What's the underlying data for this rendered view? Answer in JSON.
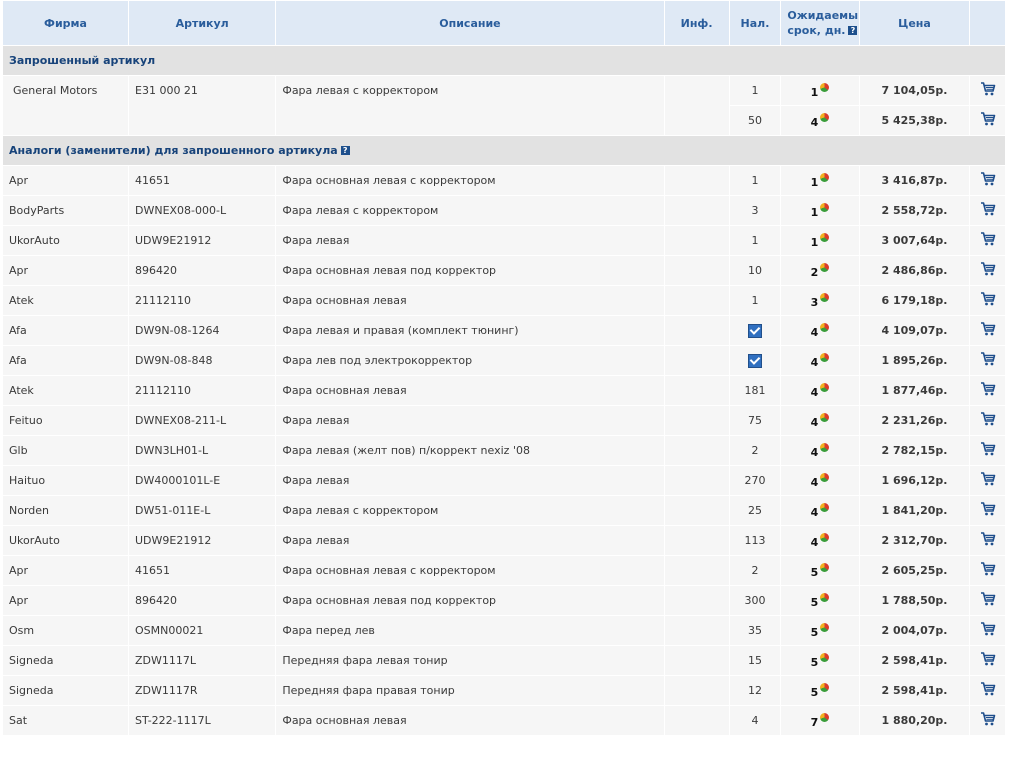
{
  "header": {
    "firm": "Фирма",
    "article": "Артикул",
    "description": "Описание",
    "info": "Инф.",
    "stock": "Нал.",
    "expected_line1": "Ожидаемый",
    "expected_line2": "срок, дн.",
    "help_glyph": "?",
    "price": "Цена"
  },
  "sections": {
    "requested": "Запрошенный артикул",
    "analogs": "Аналоги (заменители) для запрошенного артикула"
  },
  "icons": {
    "cart": "shopping-cart-icon",
    "delivery_pie": "pie-chart-icon",
    "help": "help-icon",
    "in_stock_check": "checkbox-checked-icon"
  },
  "colors": {
    "header_bg": "#dfe9f5",
    "header_text": "#2a5d9c",
    "section_bg": "#e2e2e2",
    "row_bg": "#f6f6f6",
    "link": "#1f5fa8"
  },
  "requested": {
    "firm": "General Motors",
    "article": "E31 000 21",
    "description": "Фара левая с корректором",
    "offers": [
      {
        "stock": "1",
        "days": "1",
        "price": "7 104,05р."
      },
      {
        "stock": "50",
        "days": "4",
        "price": "5 425,38р."
      }
    ]
  },
  "analogs": [
    {
      "firm": "Apr",
      "article": "41651",
      "description": "Фара основная левая с корректором",
      "stock": "1",
      "stock_check": false,
      "days": "1",
      "price": "3 416,87р."
    },
    {
      "firm": "BodyParts",
      "article": "DWNEX08-000-L",
      "description": "Фара левая с корректором",
      "stock": "3",
      "stock_check": false,
      "days": "1",
      "price": "2 558,72р."
    },
    {
      "firm": "UkorAuto",
      "article": "UDW9E21912",
      "description": "Фара левая",
      "stock": "1",
      "stock_check": false,
      "days": "1",
      "price": "3 007,64р."
    },
    {
      "firm": "Apr",
      "article": "896420",
      "description": "Фара основная левая под корректор",
      "stock": "10",
      "stock_check": false,
      "days": "2",
      "price": "2 486,86р."
    },
    {
      "firm": "Atek",
      "article": "21112110",
      "description": "Фара основная левая",
      "stock": "1",
      "stock_check": false,
      "days": "3",
      "price": "6 179,18р."
    },
    {
      "firm": "Afa",
      "article": "DW9N-08-1264",
      "description": "Фара левая и правая (комплект тюнинг)",
      "stock": "",
      "stock_check": true,
      "days": "4",
      "price": "4 109,07р."
    },
    {
      "firm": "Afa",
      "article": "DW9N-08-848",
      "description": "Фара лев под электрокорректор",
      "stock": "",
      "stock_check": true,
      "days": "4",
      "price": "1 895,26р."
    },
    {
      "firm": "Atek",
      "article": "21112110",
      "description": "Фара основная левая",
      "stock": "181",
      "stock_check": false,
      "days": "4",
      "price": "1 877,46р."
    },
    {
      "firm": "Feituo",
      "article": "DWNEX08-211-L",
      "description": "Фара левая",
      "stock": "75",
      "stock_check": false,
      "days": "4",
      "price": "2 231,26р."
    },
    {
      "firm": "Glb",
      "article": "DWN3LH01-L",
      "description": "Фара левая (желт пов) п/коррект nexiz '08",
      "stock": "2",
      "stock_check": false,
      "days": "4",
      "price": "2 782,15р."
    },
    {
      "firm": "Haituo",
      "article": "DW4000101L-E",
      "description": "Фара левая",
      "stock": "270",
      "stock_check": false,
      "days": "4",
      "price": "1 696,12р."
    },
    {
      "firm": "Norden",
      "article": "DW51-011E-L",
      "description": "Фара левая с корректором",
      "stock": "25",
      "stock_check": false,
      "days": "4",
      "price": "1 841,20р."
    },
    {
      "firm": "UkorAuto",
      "article": "UDW9E21912",
      "description": "Фара левая",
      "stock": "113",
      "stock_check": false,
      "days": "4",
      "price": "2 312,70р."
    },
    {
      "firm": "Apr",
      "article": "41651",
      "description": "Фара основная левая с корректором",
      "stock": "2",
      "stock_check": false,
      "days": "5",
      "price": "2 605,25р."
    },
    {
      "firm": "Apr",
      "article": "896420",
      "description": "Фара основная левая под корректор",
      "stock": "300",
      "stock_check": false,
      "days": "5",
      "price": "1 788,50р."
    },
    {
      "firm": "Osm",
      "article": "OSMN00021",
      "description": "Фара перед лев",
      "stock": "35",
      "stock_check": false,
      "days": "5",
      "price": "2 004,07р."
    },
    {
      "firm": "Signeda",
      "article": "ZDW1117L",
      "description": "Передняя фара левая тонир",
      "stock": "15",
      "stock_check": false,
      "days": "5",
      "price": "2 598,41р."
    },
    {
      "firm": "Signeda",
      "article": "ZDW1117R",
      "description": "Передняя фара правая тонир",
      "stock": "12",
      "stock_check": false,
      "days": "5",
      "price": "2 598,41р."
    },
    {
      "firm": "Sat",
      "article": "ST-222-1117L",
      "description": "Фара основная левая",
      "stock": "4",
      "stock_check": false,
      "days": "7",
      "price": "1 880,20р."
    }
  ]
}
